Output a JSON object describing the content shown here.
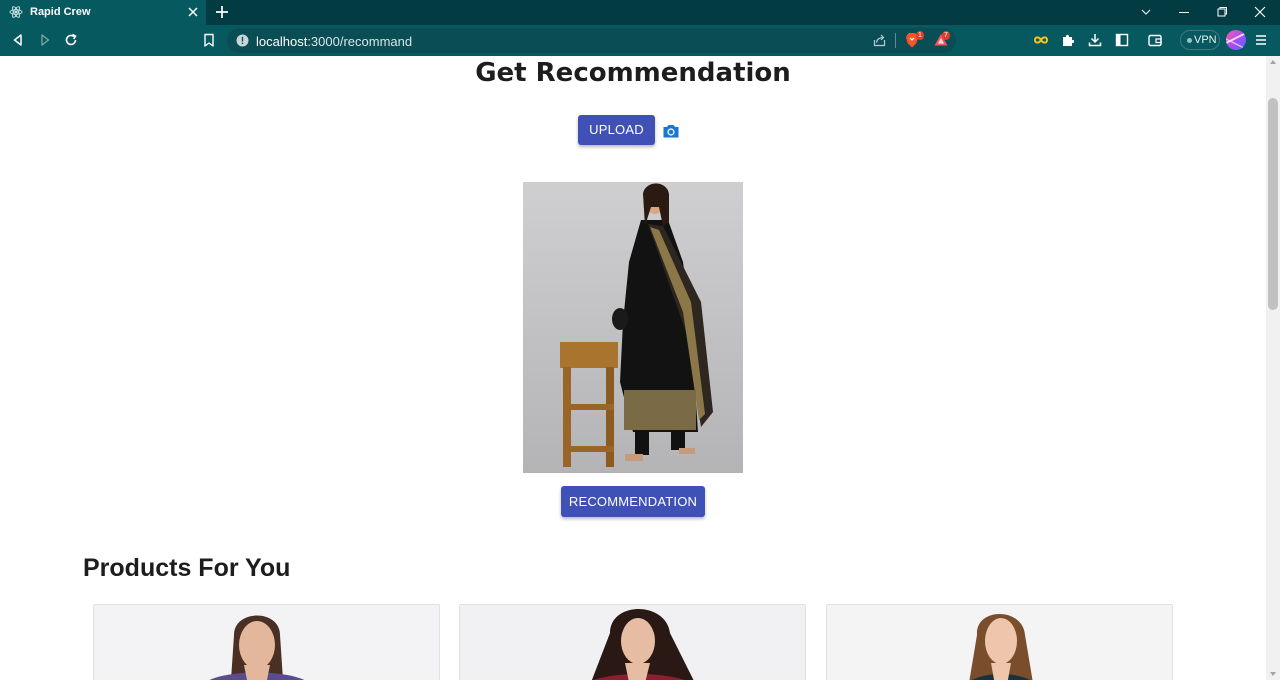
{
  "browser": {
    "tab_title": "Rapid Crew",
    "url_host": "localhost",
    "url_path": ":3000/recommand",
    "shield_badge": "1",
    "rewards_badge": "7",
    "vpn_label": "VPN",
    "theme_color": "#06595f"
  },
  "page": {
    "title": "Get Recommendation",
    "upload_label": "UPLOAD",
    "recommendation_label": "RECOMMENDATION",
    "section_title": "Products For You",
    "accent_color": "#3f51b5",
    "camera_icon_color": "#1976d2"
  },
  "products": [
    {
      "top_color": "#5b4c8f"
    },
    {
      "top_color": "#8b1f2f"
    },
    {
      "top_color": "#17323f"
    }
  ]
}
